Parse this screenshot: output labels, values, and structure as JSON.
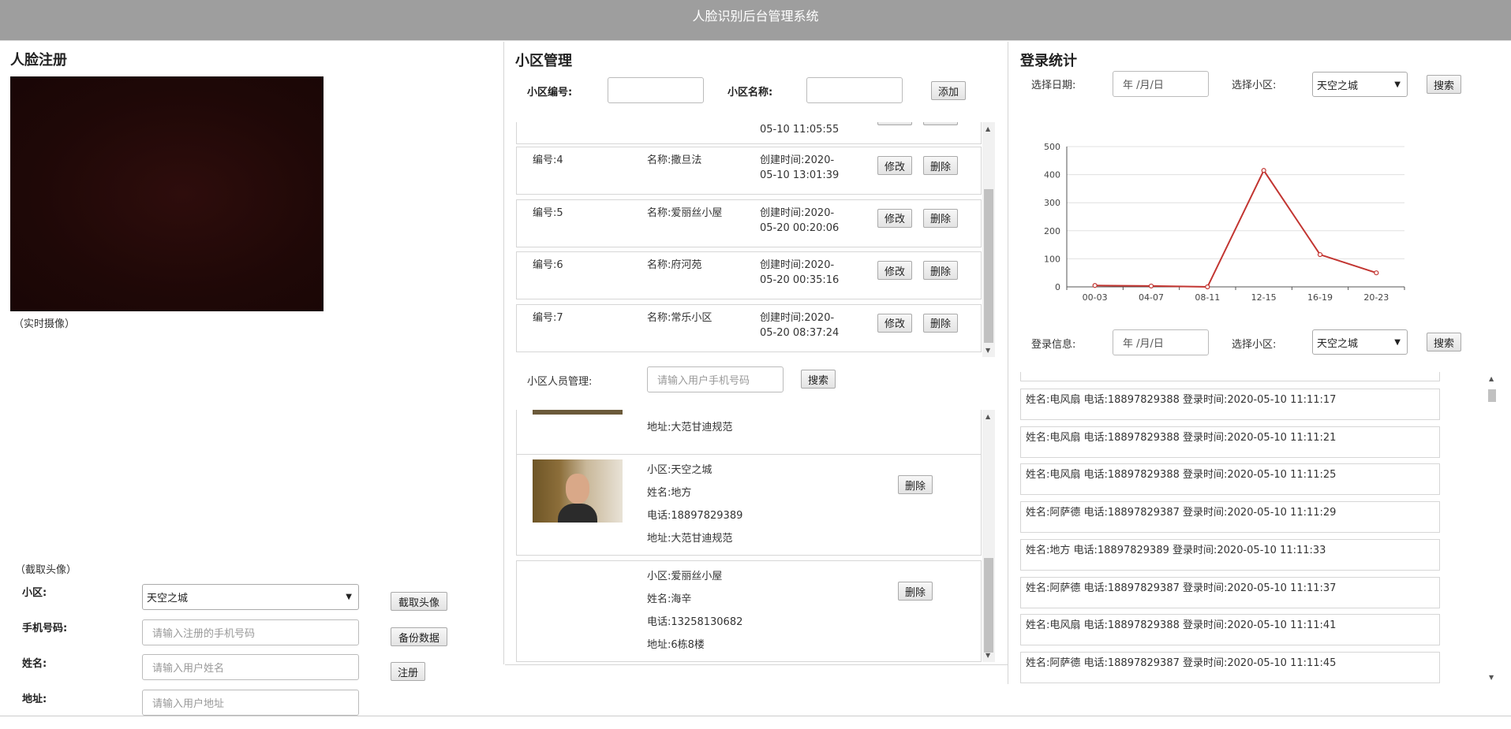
{
  "app_title": "人脸识别后台管理系统",
  "face_reg": {
    "title": "人脸注册",
    "camera_caption": "（实时摄像）",
    "capture_caption": "（截取头像）",
    "labels": {
      "community": "小区:",
      "phone": "手机号码:",
      "name": "姓名:",
      "address": "地址:"
    },
    "community_value": "天空之城",
    "phone_placeholder": "请输入注册的手机号码",
    "name_placeholder": "请输入用户姓名",
    "address_placeholder": "请输入用户地址",
    "buttons": {
      "capture": "截取头像",
      "backup": "备份数据",
      "register": "注册"
    }
  },
  "community_mgmt": {
    "title": "小区管理",
    "id_label": "小区编号:",
    "name_label": "小区名称:",
    "add_button": "添加",
    "partial_top_text": "05-10 11:05:55",
    "rows": [
      {
        "id": "编号:4",
        "name": "名称:撒旦法",
        "created1": "创建时间:2020-",
        "created2": "05-10 13:01:39",
        "edit": "修改",
        "delete": "删除"
      },
      {
        "id": "编号:5",
        "name": "名称:爱丽丝小屋",
        "created1": "创建时间:2020-",
        "created2": "05-20 00:20:06",
        "edit": "修改",
        "delete": "删除"
      },
      {
        "id": "编号:6",
        "name": "名称:府河苑",
        "created1": "创建时间:2020-",
        "created2": "05-20 00:35:16",
        "edit": "修改",
        "delete": "删除"
      },
      {
        "id": "编号:7",
        "name": "名称:常乐小区",
        "created1": "创建时间:2020-",
        "created2": "05-20 08:37:24",
        "edit": "修改",
        "delete": "删除"
      }
    ],
    "residents_label": "小区人员管理:",
    "residents_placeholder": "请输入用户手机号码",
    "residents_search": "搜索",
    "partial_resident_address": "地址:大范甘迪规范",
    "residents": [
      {
        "community": "小区:天空之城",
        "name": "姓名:地方",
        "phone": "电话:18897829389",
        "address": "地址:大范甘迪规范",
        "delete": "删除"
      },
      {
        "community": "小区:爱丽丝小屋",
        "name": "姓名:海辛",
        "phone": "电话:13258130682",
        "address": "地址:6栋8楼",
        "delete": "删除"
      }
    ]
  },
  "login_stats": {
    "title": "登录统计",
    "date_label": "选择日期:",
    "date_placeholder": "年 /月/日",
    "community_label": "选择小区:",
    "community_value": "天空之城",
    "search": "搜索",
    "info_label": "登录信息:",
    "logs": [
      "姓名:电风扇 电话:18897829388 登录时间:2020-05-10 11:11:17",
      "姓名:电风扇 电话:18897829388 登录时间:2020-05-10 11:11:21",
      "姓名:电风扇 电话:18897829388 登录时间:2020-05-10 11:11:25",
      "姓名:阿萨德 电话:18897829387 登录时间:2020-05-10 11:11:29",
      "姓名:地方 电话:18897829389 登录时间:2020-05-10 11:11:33",
      "姓名:阿萨德 电话:18897829387 登录时间:2020-05-10 11:11:37",
      "姓名:电风扇 电话:18897829388 登录时间:2020-05-10 11:11:41",
      "姓名:阿萨德 电话:18897829387 登录时间:2020-05-10 11:11:45"
    ]
  },
  "chart_data": {
    "type": "line",
    "categories": [
      "00-03",
      "04-07",
      "08-11",
      "12-15",
      "16-19",
      "20-23"
    ],
    "values": [
      5,
      3,
      0,
      415,
      115,
      50
    ],
    "ylim": [
      0,
      500
    ],
    "yticks": [
      0,
      100,
      200,
      300,
      400,
      500
    ],
    "grid": true,
    "color": "#c23531"
  }
}
